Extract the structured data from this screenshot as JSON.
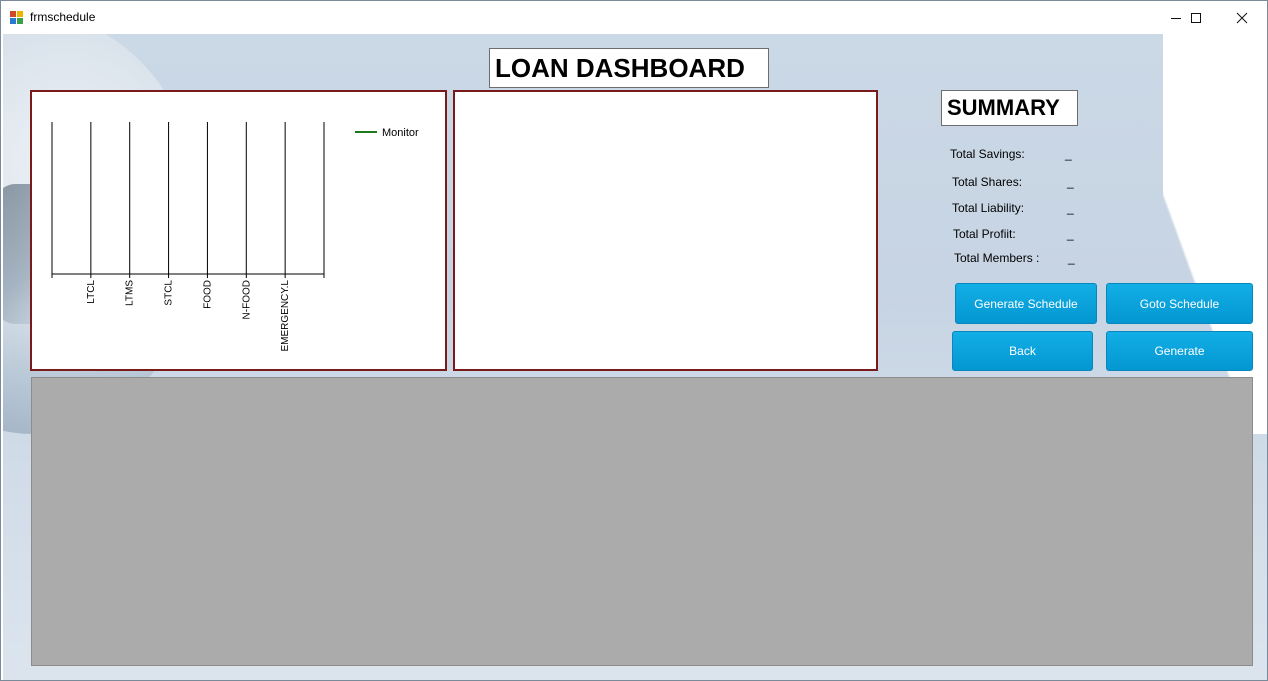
{
  "window": {
    "title": "frmschedule"
  },
  "page_title": "LOAN DASHBOARD",
  "summary": {
    "heading": "SUMMARY",
    "items": [
      {
        "label": "Total Savings:",
        "value": "_"
      },
      {
        "label": "Total Shares:",
        "value": "_"
      },
      {
        "label": "Total Liability:",
        "value": "_"
      },
      {
        "label": "Total Profiit:",
        "value": "_"
      },
      {
        "label": "Total Members :",
        "value": "_"
      }
    ]
  },
  "buttons": {
    "generate_schedule": "Generate Schedule",
    "goto_schedule": "Goto Schedule",
    "back": "Back",
    "generate": "Generate"
  },
  "chart_data": {
    "type": "line",
    "categories": [
      "LTCL",
      "LTMS",
      "STCL",
      "FOOD",
      "N-FOOD",
      "EMERGENCY.L"
    ],
    "series": [
      {
        "name": "Monitor",
        "values": []
      }
    ],
    "legend_position": "top-right",
    "colors": {
      "Monitor": "#1a7a1a"
    },
    "grid": true
  }
}
